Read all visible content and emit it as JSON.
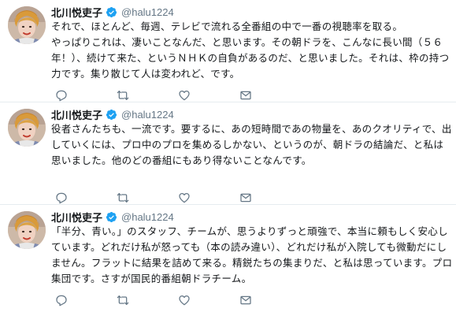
{
  "accent_color": "#1da1f2",
  "icon_color": "#657786",
  "tweets": [
    {
      "author": {
        "name": "北川悦吏子",
        "handle": "@halu1224",
        "verified": true,
        "avatar_icon": "profile-photo"
      },
      "text": "それで、ほとんど、毎週、テレビで流れる全番組の中で一番の視聴率を取る。\nやっぱりこれは、凄いことなんだ、と思います。その朝ドラを、こんなに長い間（５６年！）、続けて来た、というＮＨＫの自負があるのだ、と思いました。それは、枠の持つ力です。集り散じて人は変われど、です。",
      "actions": [
        "reply-icon",
        "retweet-icon",
        "like-icon",
        "message-icon"
      ]
    },
    {
      "author": {
        "name": "北川悦吏子",
        "handle": "@halu1224",
        "verified": true,
        "avatar_icon": "profile-photo"
      },
      "text": "役者さんたちも、一流です。要するに、あの短時間であの物量を、あのクオリティで、出していくには、プロ中のプロを集めるしかない、というのが、朝ドラの結論だ、と私は思いました。他のどの番組にもあり得ないことなんです。",
      "actions": [
        "reply-icon",
        "retweet-icon",
        "like-icon",
        "message-icon"
      ]
    },
    {
      "author": {
        "name": "北川悦吏子",
        "handle": "@halu1224",
        "verified": true,
        "avatar_icon": "profile-photo"
      },
      "text": "「半分、青い。」のスタッフ、チームが、思うよりずっと頑強で、本当に頼もしく安心しています。どれだけ私が怒っても（本の読み違い）、どれだけ私が入院しても微動だにしません。フラットに結果を詰めて来る。精鋭たちの集まりだ、と私は思っています。プロ集団です。さすが国民的番組朝ドラチーム。",
      "actions": [
        "reply-icon",
        "retweet-icon",
        "like-icon",
        "message-icon"
      ]
    }
  ]
}
